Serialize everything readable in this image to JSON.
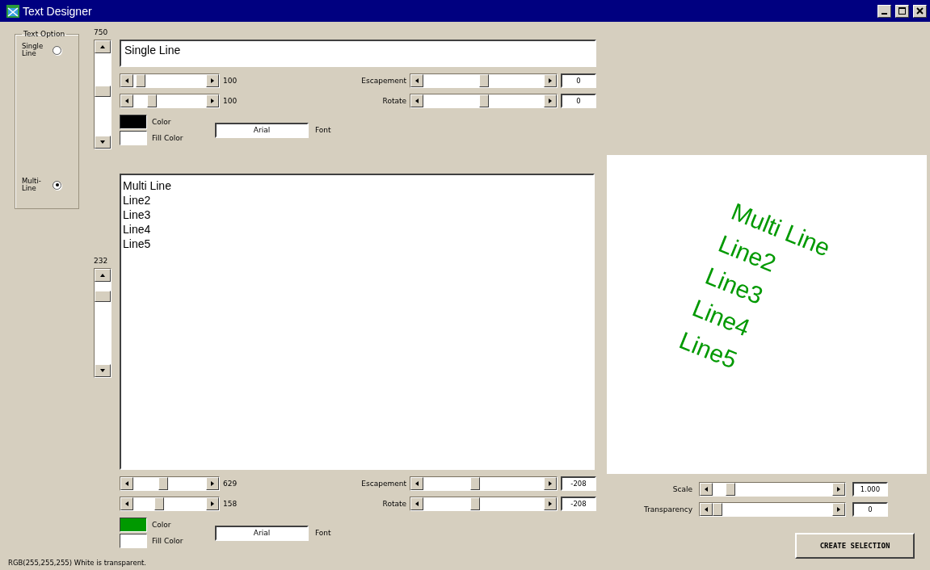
{
  "window": {
    "title": "Text Designer"
  },
  "text_option": {
    "title": "Text Option",
    "options": [
      {
        "label": "Single Line",
        "selected": false
      },
      {
        "label": "Multi-Line",
        "selected": true
      }
    ]
  },
  "single": {
    "scroll_reading": "750",
    "text": "Single Line",
    "sliders": [
      {
        "reading": "100"
      },
      {
        "reading": "100"
      }
    ],
    "angles": [
      {
        "label": "Escapement",
        "value": "0"
      },
      {
        "label": "Rotate",
        "value": "0"
      }
    ],
    "color": {
      "label": "Color",
      "color": "#000000"
    },
    "fill": {
      "label": "Fill Color",
      "color": "#ffffff"
    },
    "font": {
      "value": "Arial",
      "label": "Font"
    }
  },
  "multi": {
    "scroll_reading": "232",
    "lines": [
      "Multi Line",
      "Line2",
      "Line3",
      "Line4",
      "Line5"
    ],
    "sliders": [
      {
        "reading": "629"
      },
      {
        "reading": "158"
      }
    ],
    "angles": [
      {
        "label": "Escapement",
        "value": "-208"
      },
      {
        "label": "Rotate",
        "value": "-208"
      }
    ],
    "color": {
      "label": "Color",
      "color": "#009900"
    },
    "fill": {
      "label": "Fill Color",
      "color": "#ffffff"
    },
    "font": {
      "value": "Arial",
      "label": "Font"
    }
  },
  "preview": {
    "lines": [
      "Multi Line",
      "Line2",
      "Line3",
      "Line4",
      "Line5"
    ],
    "color": "#009900"
  },
  "adjust": [
    {
      "label": "Scale",
      "value": "1.000"
    },
    {
      "label": "Transparency",
      "value": "0"
    }
  ],
  "create_button": "CREATE SELECTION",
  "status": "RGB(255,255,255) White is transparent."
}
